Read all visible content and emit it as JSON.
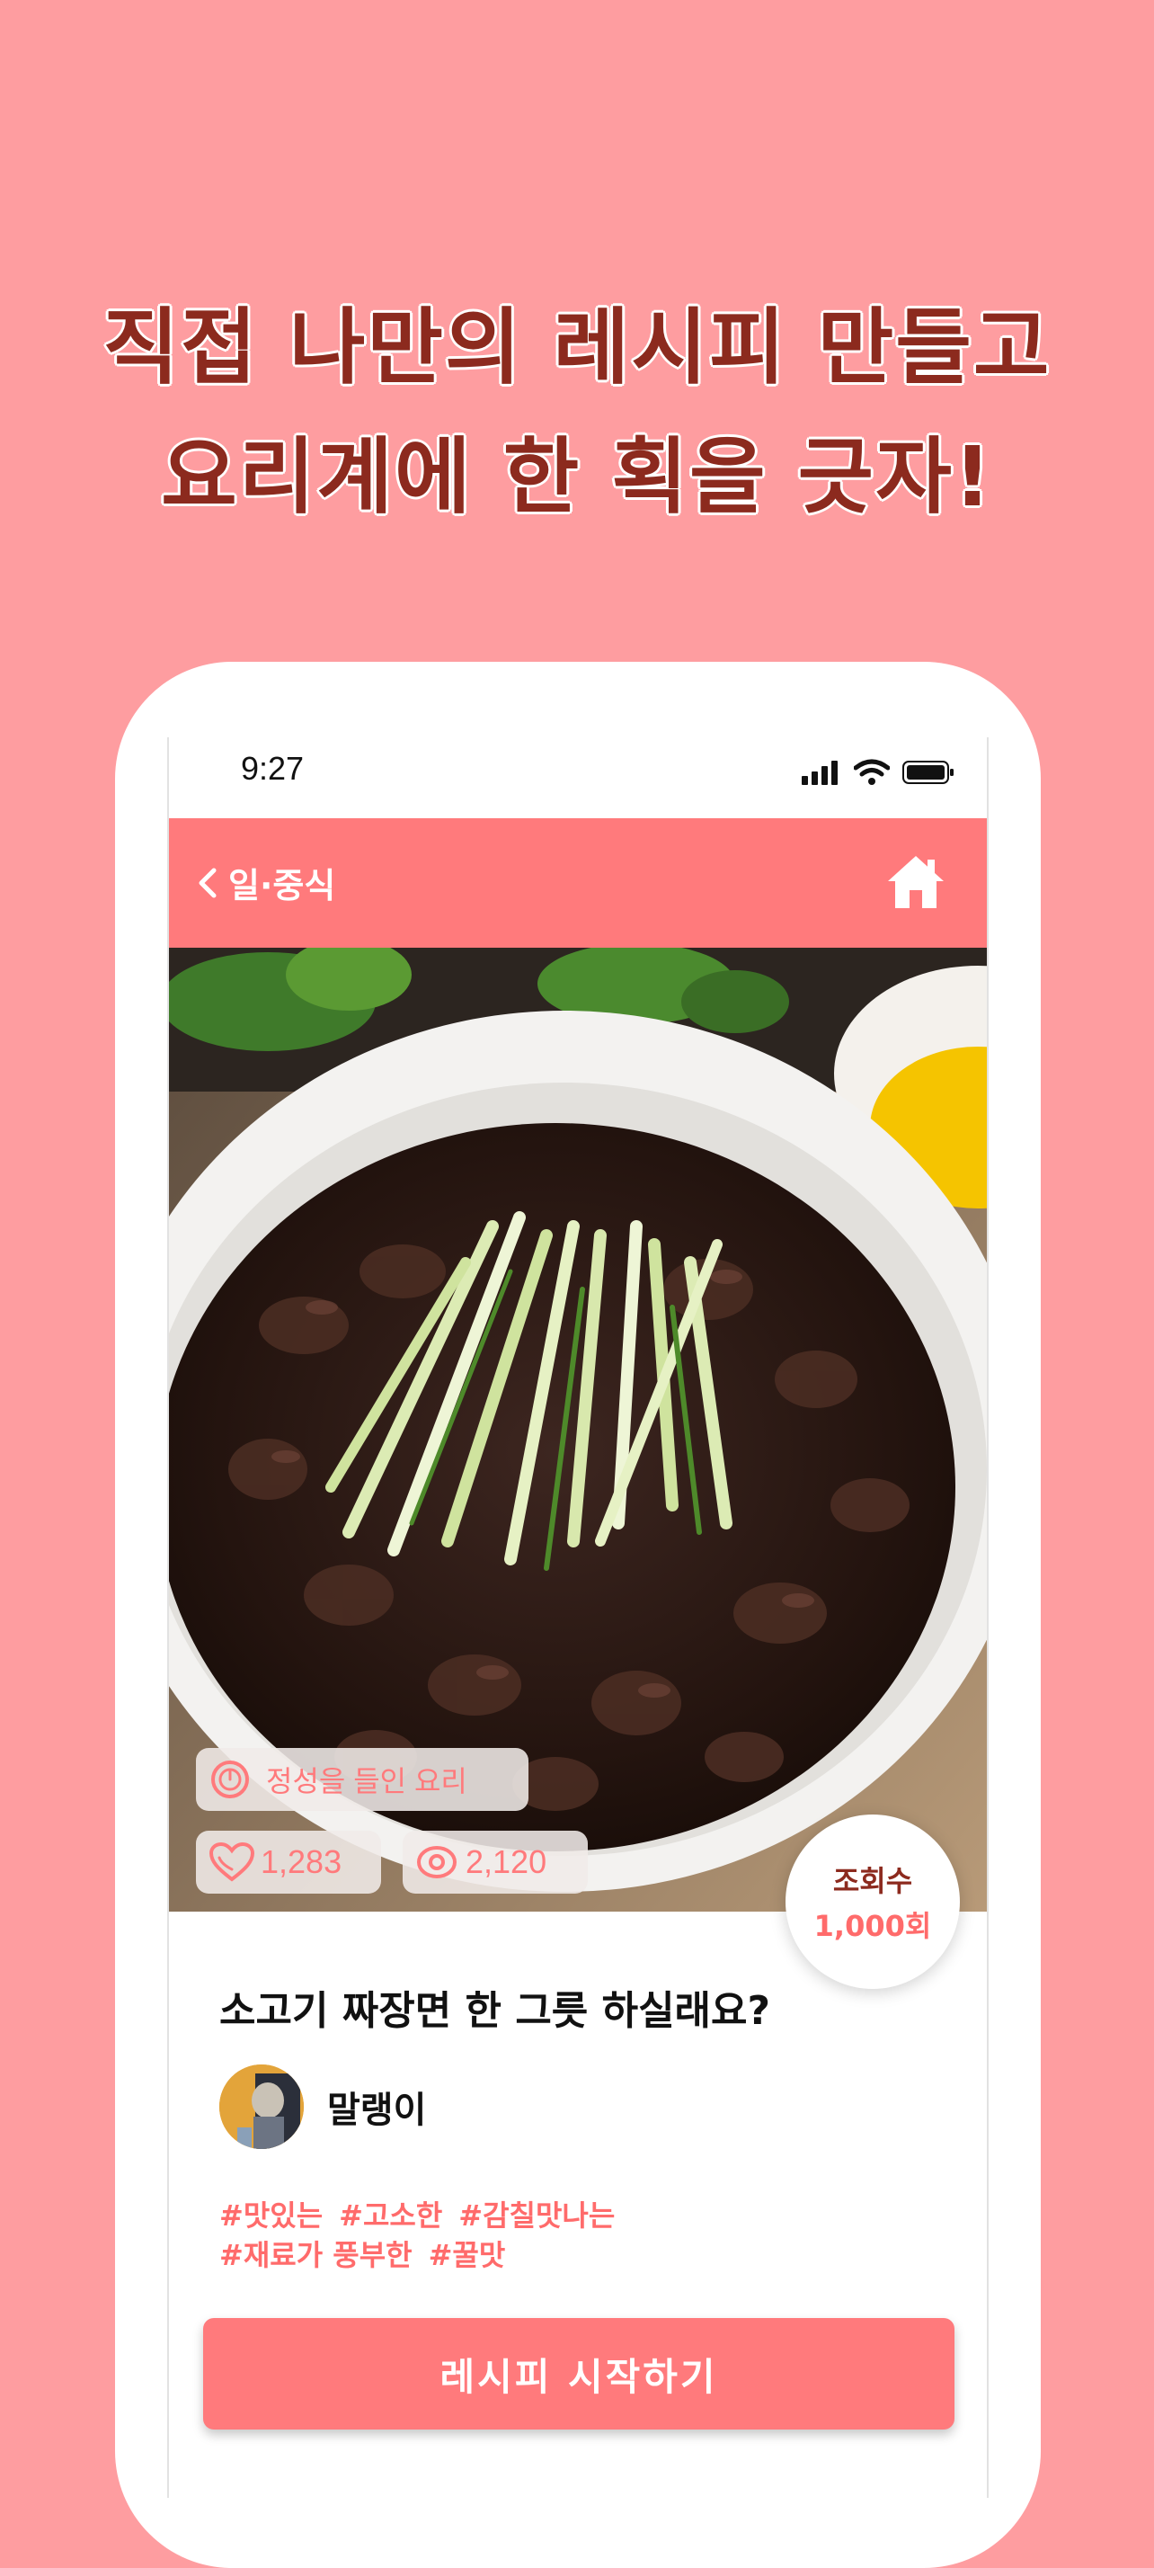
{
  "headline": {
    "line1": "직접 나만의 레시피 만들고",
    "line2": "요리계에 한 획을 긋자!"
  },
  "status_bar": {
    "time": "9:27",
    "icons": [
      "signal-icon",
      "wifi-icon",
      "battery-icon"
    ]
  },
  "nav": {
    "back_icon": "chevron-left-icon",
    "title": "일·중식",
    "home_icon": "home-icon"
  },
  "recipe": {
    "tag": "정성을 들인 요리",
    "tag_icon": "timer-icon",
    "likes": "1,283",
    "likes_icon": "heart-icon",
    "views": "2,120",
    "views_icon": "eye-icon",
    "view_badge": {
      "label": "조회수",
      "count": "1,000회"
    },
    "title": "소고기 짜장면 한 그릇 하실래요?",
    "author": "말랭이",
    "hashtags_line1": [
      "#맛있는",
      "#고소한",
      "#감칠맛나는"
    ],
    "hashtags_line2": [
      "#재료가 풍부한",
      "#꿀맛"
    ],
    "start_button": "레시피 시작하기"
  },
  "colors": {
    "background": "#FE9DA0",
    "accent": "#FF7A7C",
    "headline": "#8C2A1E",
    "hashtag": "#FF6B6B"
  }
}
